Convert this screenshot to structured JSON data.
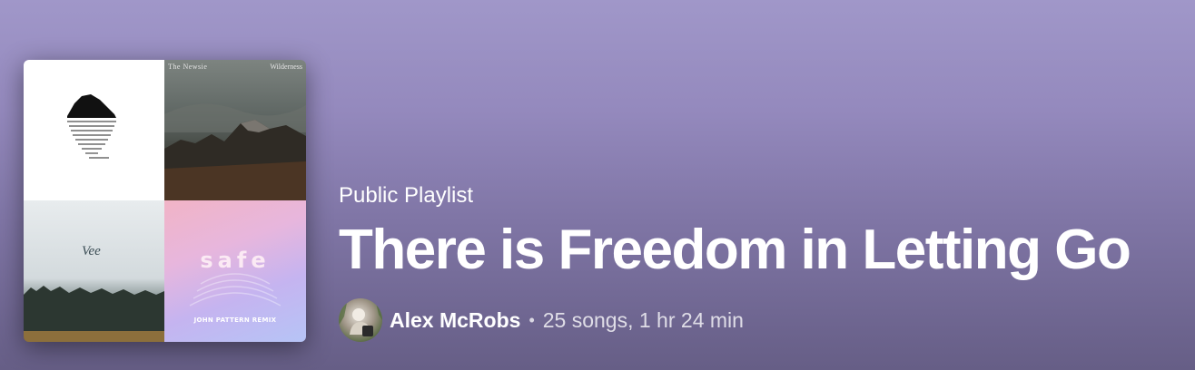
{
  "playlist": {
    "type_label": "Public Playlist",
    "title": "There is Freedom in Letting Go",
    "owner": "Alex McRobs",
    "separator": "•",
    "stats": "25 songs, 1 hr 24 min"
  },
  "cover": {
    "tiles": [
      {
        "name": "island-reflection-artwork",
        "text": []
      },
      {
        "name": "mountain-night-sky-artwork",
        "text": [
          "The Newsie",
          "Wilderness"
        ]
      },
      {
        "name": "foggy-forest-artwork",
        "text": [
          "Vee"
        ]
      },
      {
        "name": "pastel-gradient-artwork",
        "text": [
          "safe",
          "JOHN PATTERN REMIX"
        ]
      }
    ]
  },
  "colors": {
    "background_top": "#a097c9",
    "background_bottom": "#665e86",
    "text_primary": "#ffffff"
  }
}
